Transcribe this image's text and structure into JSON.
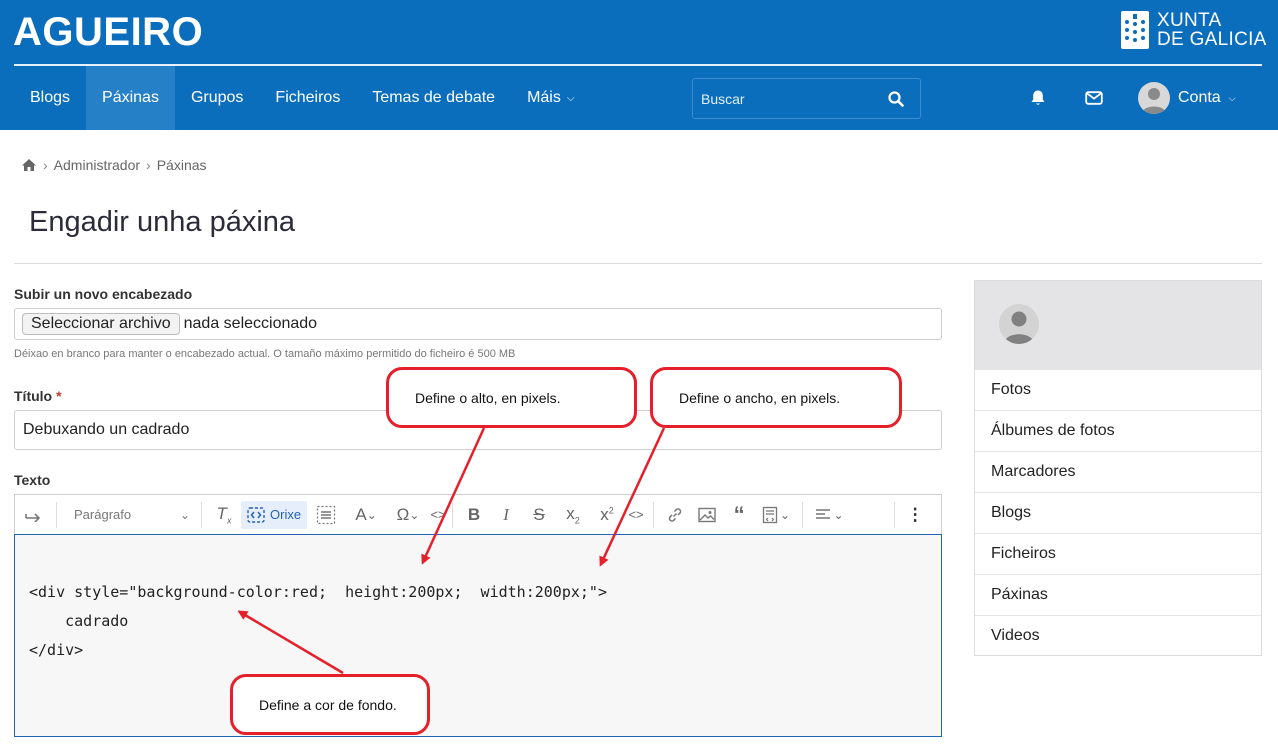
{
  "header": {
    "brand": "AGUEIRO",
    "xunta_line1": "XUNTA",
    "xunta_line2": "DE GALICIA",
    "colors": {
      "header_bg": "#0a6ebd",
      "active_tab": "#2680c7"
    }
  },
  "nav": {
    "items": [
      "Blogs",
      "Páxinas",
      "Grupos",
      "Ficheiros",
      "Temas de debate",
      "Máis"
    ],
    "active": "Páxinas",
    "search_placeholder": "Buscar",
    "account_label": "Conta"
  },
  "breadcrumb": {
    "home_icon": "home-icon",
    "items": [
      "Administrador",
      "Páxinas"
    ]
  },
  "page": {
    "title": "Engadir unha páxina"
  },
  "form": {
    "header_label": "Subir un novo encabezado",
    "file_button": "Seleccionar archivo",
    "file_status": "nada seleccionado",
    "help": "Déixao en branco para manter o encabezado actual. O tamaño máximo permitido do ficheiro é 500 MB",
    "title_label": "Título",
    "required_mark": "*",
    "title_value": "Debuxando un cadrado",
    "text_label": "Texto"
  },
  "editor": {
    "paragraph_select": "Parágrafo",
    "source_button": "Orixe",
    "code": [
      "<div style=\"background-color:red;  height:200px;  width:200px;\">",
      "    cadrado",
      "</div>"
    ]
  },
  "sidebar": {
    "items": [
      "Fotos",
      "Álbumes de fotos",
      "Marcadores",
      "Blogs",
      "Ficheiros",
      "Páxinas",
      "Videos"
    ]
  },
  "annotations": {
    "height": "Define o alto, en pixels.",
    "width": "Define o ancho, en pixels.",
    "background": "Define a cor de fondo.",
    "color": "#e5202a"
  }
}
